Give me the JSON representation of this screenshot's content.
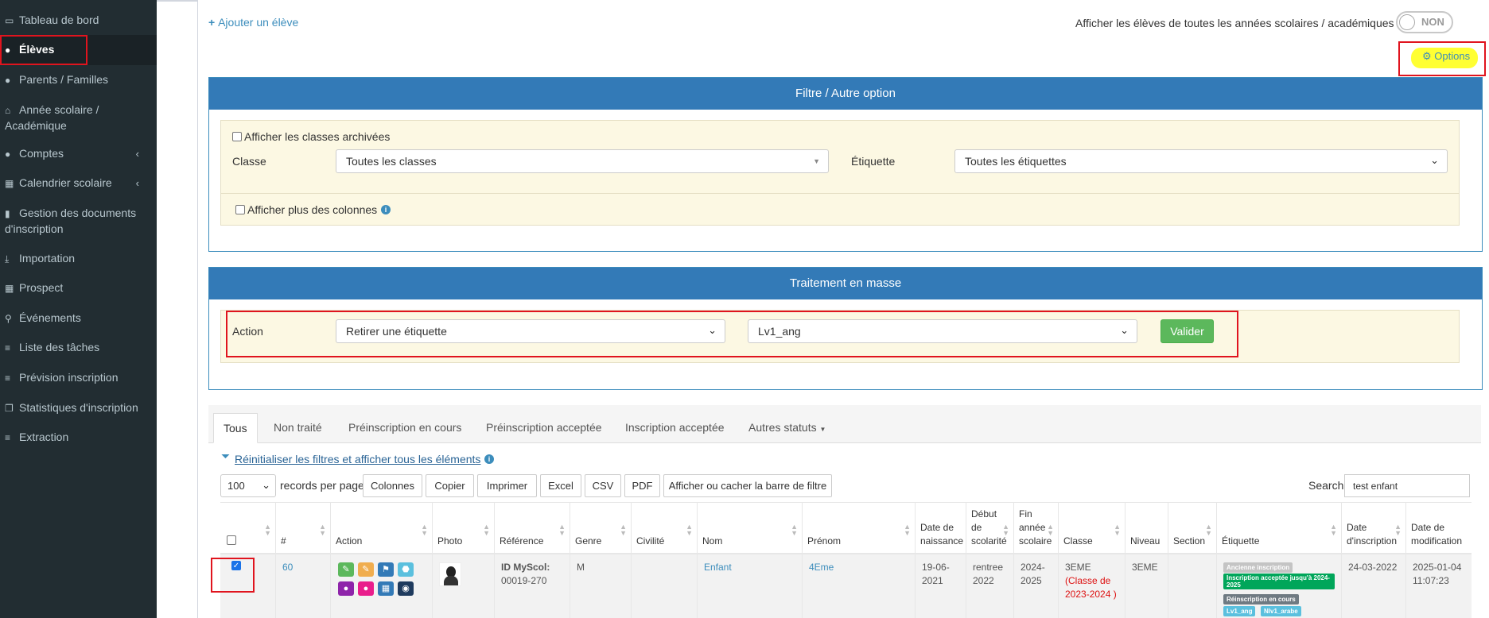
{
  "sidebar": {
    "items": [
      {
        "label": "Tableau de bord",
        "icon": "laptop-icon"
      },
      {
        "label": "Élèves",
        "icon": "user-icon"
      },
      {
        "label": "Parents / Familles",
        "icon": "user-icon"
      },
      {
        "label": "Année scolaire /",
        "label2": "Académique",
        "icon": "home-icon"
      },
      {
        "label": "Comptes",
        "icon": "users-icon"
      },
      {
        "label": "Calendrier scolaire",
        "icon": "calendar-icon"
      },
      {
        "label": "Gestion des documents",
        "label2": "d'inscription",
        "icon": "file-icon"
      },
      {
        "label": "Importation",
        "icon": "download-icon"
      },
      {
        "label": "Prospect",
        "icon": "grid-icon"
      },
      {
        "label": "Événements",
        "icon": "map-marker-icon"
      },
      {
        "label": "Liste des tâches",
        "icon": "list-icon"
      },
      {
        "label": "Prévision inscription",
        "icon": "list-icon"
      },
      {
        "label": "Statistiques d'inscription",
        "icon": "copy-icon"
      },
      {
        "label": "Extraction",
        "icon": "list-icon"
      }
    ]
  },
  "header": {
    "add_student": "Ajouter un élève",
    "show_all_years": "Afficher les élèves de toutes les années scolaires / académiques",
    "toggle_state": "NON",
    "options": "Options"
  },
  "filter": {
    "title": "Filtre / Autre option",
    "archived_label": "Afficher les classes archivées",
    "class_label": "Classe",
    "class_value": "Toutes les classes",
    "tag_label": "Étiquette",
    "tag_value": "Toutes les étiquettes",
    "more_columns_label": "Afficher plus des colonnes"
  },
  "bulk": {
    "title": "Traitement en masse",
    "action_label": "Action",
    "action_value": "Retirer une étiquette",
    "tag_value": "Lv1_ang",
    "validate": "Valider"
  },
  "tabs": [
    "Tous",
    "Non traité",
    "Préinscription en cours",
    "Préinscription acceptée",
    "Inscription acceptée",
    "Autres statuts"
  ],
  "toolbar": {
    "reset_filters": "Réinitialiser les filtres et afficher tous les éléments",
    "page_size": "100",
    "records_per_page": "records per page",
    "buttons": [
      "Colonnes",
      "Copier",
      "Imprimer",
      "Excel",
      "CSV",
      "PDF",
      "Afficher ou cacher la barre de filtre"
    ],
    "search_label": "Search:",
    "search_value": "test enfant"
  },
  "table": {
    "headers": [
      "#",
      "Action",
      "Photo",
      "Référence",
      "Genre",
      "Civilité",
      "Nom",
      "Prénom",
      "Date de naissance",
      "Début de scolarité",
      "Fin année scolaire",
      "Classe",
      "Niveau",
      "Section",
      "Étiquette",
      "Date d'inscription",
      "Date de modification"
    ],
    "row": {
      "id": "60",
      "ref_label": "ID MyScol:",
      "ref_value": "00019-270",
      "genre": "M",
      "civilite": "",
      "nom": "Enfant",
      "prenom": "4Eme",
      "naissance": "19-06-2021",
      "debut": "rentree 2022",
      "fin": "2024-2025",
      "classe": "3EME",
      "classe_note": "(Classe de 2023-2024 )",
      "niveau": "3EME",
      "section": "",
      "tags": [
        "Ancienne inscription",
        "Inscription acceptée jusqu'à 2024-2025",
        "Réinscription en cours",
        "Lv1_ang",
        "Nlv1_arabe"
      ],
      "date_inscription": "24-03-2022",
      "date_modification": "2025-01-04 11:07:23"
    }
  },
  "colors": {
    "sidebar": "#222d32",
    "panel_head": "#337ab7",
    "well": "#fcf8e3",
    "green": "#5cb85c",
    "highlight": "#ffff33"
  }
}
